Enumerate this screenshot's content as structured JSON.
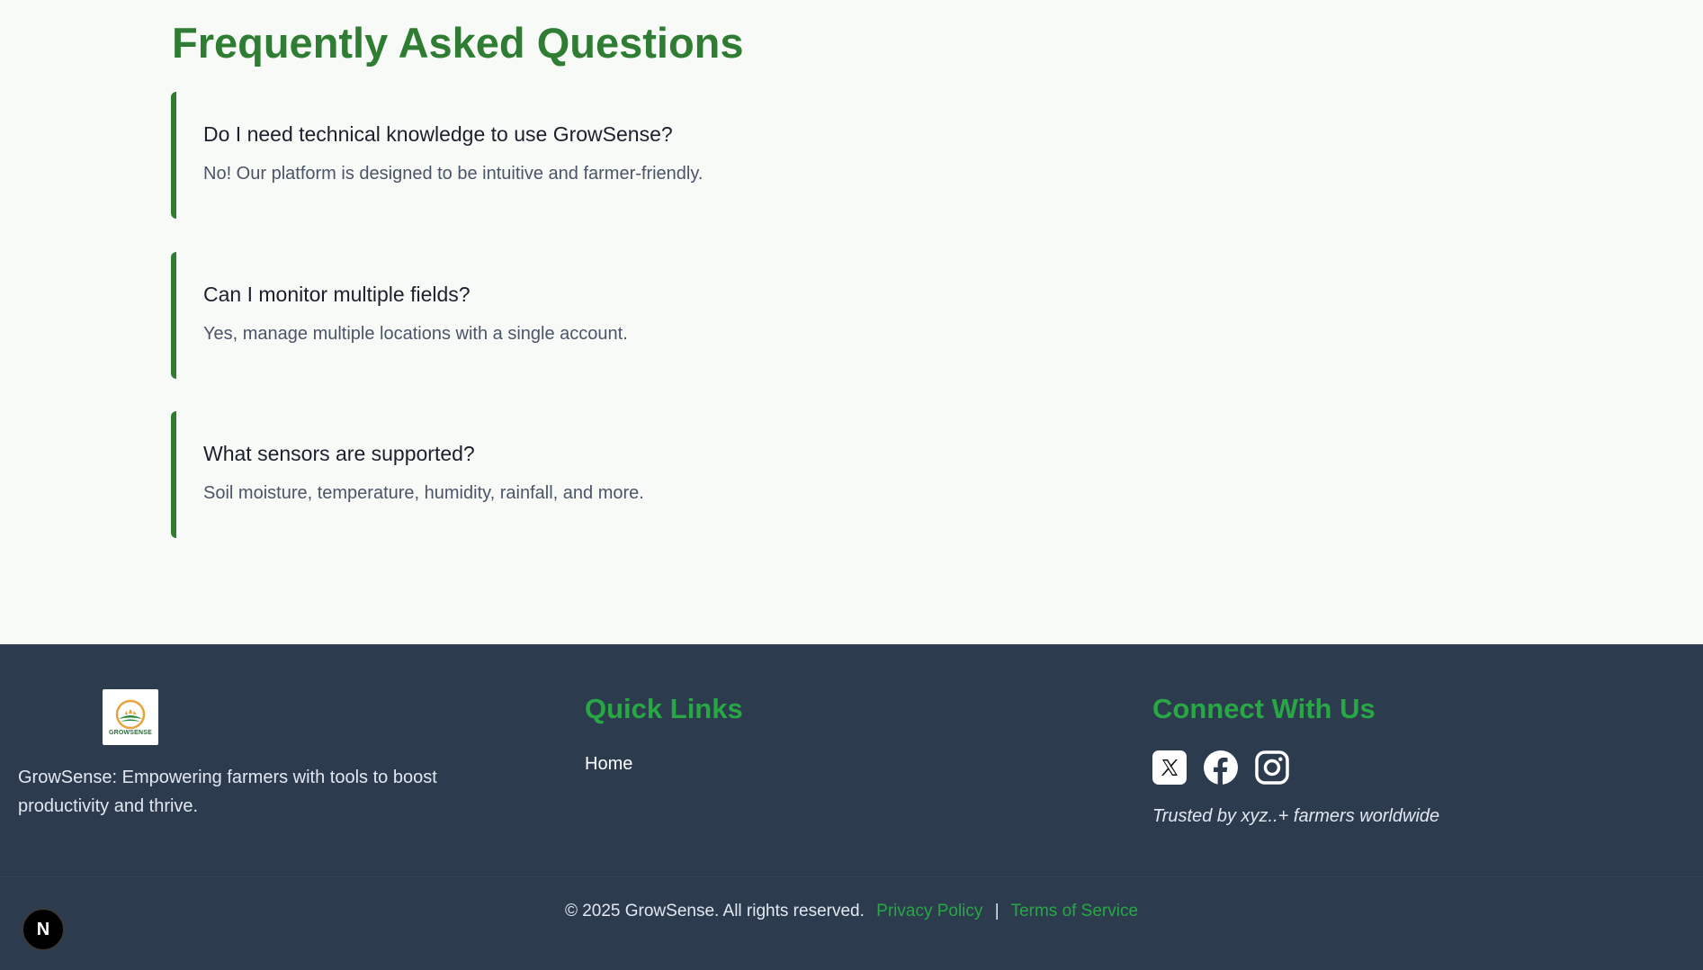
{
  "faq": {
    "title": "Frequently Asked Questions",
    "items": [
      {
        "question": "Do I need technical knowledge to use GrowSense?",
        "answer": "No! Our platform is designed to be intuitive and farmer-friendly."
      },
      {
        "question": "Can I monitor multiple fields?",
        "answer": "Yes, manage multiple locations with a single account."
      },
      {
        "question": "What sensors are supported?",
        "answer": "Soil moisture, temperature, humidity, rainfall, and more."
      }
    ]
  },
  "footer": {
    "logo_text": "GROWSENSE",
    "tagline": "GrowSense: Empowering farmers with tools to boost productivity and thrive.",
    "quick_links": {
      "heading": "Quick Links",
      "links": [
        "Home"
      ]
    },
    "connect": {
      "heading": "Connect With Us",
      "icons": [
        "x-twitter-icon",
        "facebook-icon",
        "instagram-icon"
      ],
      "trusted": "Trusted by xyz..+ farmers worldwide"
    },
    "bottom": {
      "copyright": "© 2025 GrowSense. All rights reserved.",
      "privacy": "Privacy Policy",
      "separator": "|",
      "terms": "Terms of Service"
    }
  },
  "dev_badge": {
    "label": "N"
  },
  "colors": {
    "accent_green": "#2e7d32",
    "link_green": "#27a844",
    "footer_bg": "#2d3b4f",
    "page_bg": "#f8faf8"
  }
}
